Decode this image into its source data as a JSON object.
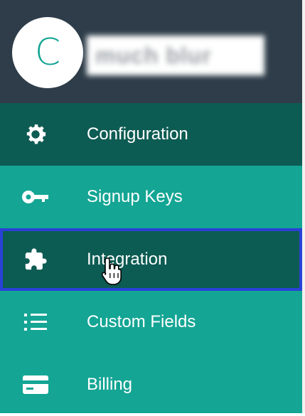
{
  "account": {
    "avatar_letter": "C",
    "name_blurred": "much blur"
  },
  "menu": {
    "items": [
      {
        "label": "Configuration",
        "icon": "gear-icon",
        "state": "active"
      },
      {
        "label": "Signup Keys",
        "icon": "key-icon",
        "state": "normal"
      },
      {
        "label": "Integration",
        "icon": "puzzle-icon",
        "state": "hovered-selected"
      },
      {
        "label": "Custom Fields",
        "icon": "list-icon",
        "state": "normal"
      },
      {
        "label": "Billing",
        "icon": "credit-card-icon",
        "state": "normal"
      }
    ]
  },
  "colors": {
    "header_bg": "#2e3d49",
    "menu_bg": "#14a594",
    "menu_active_bg": "#0d5c53",
    "selection_outline": "#2941d6"
  }
}
